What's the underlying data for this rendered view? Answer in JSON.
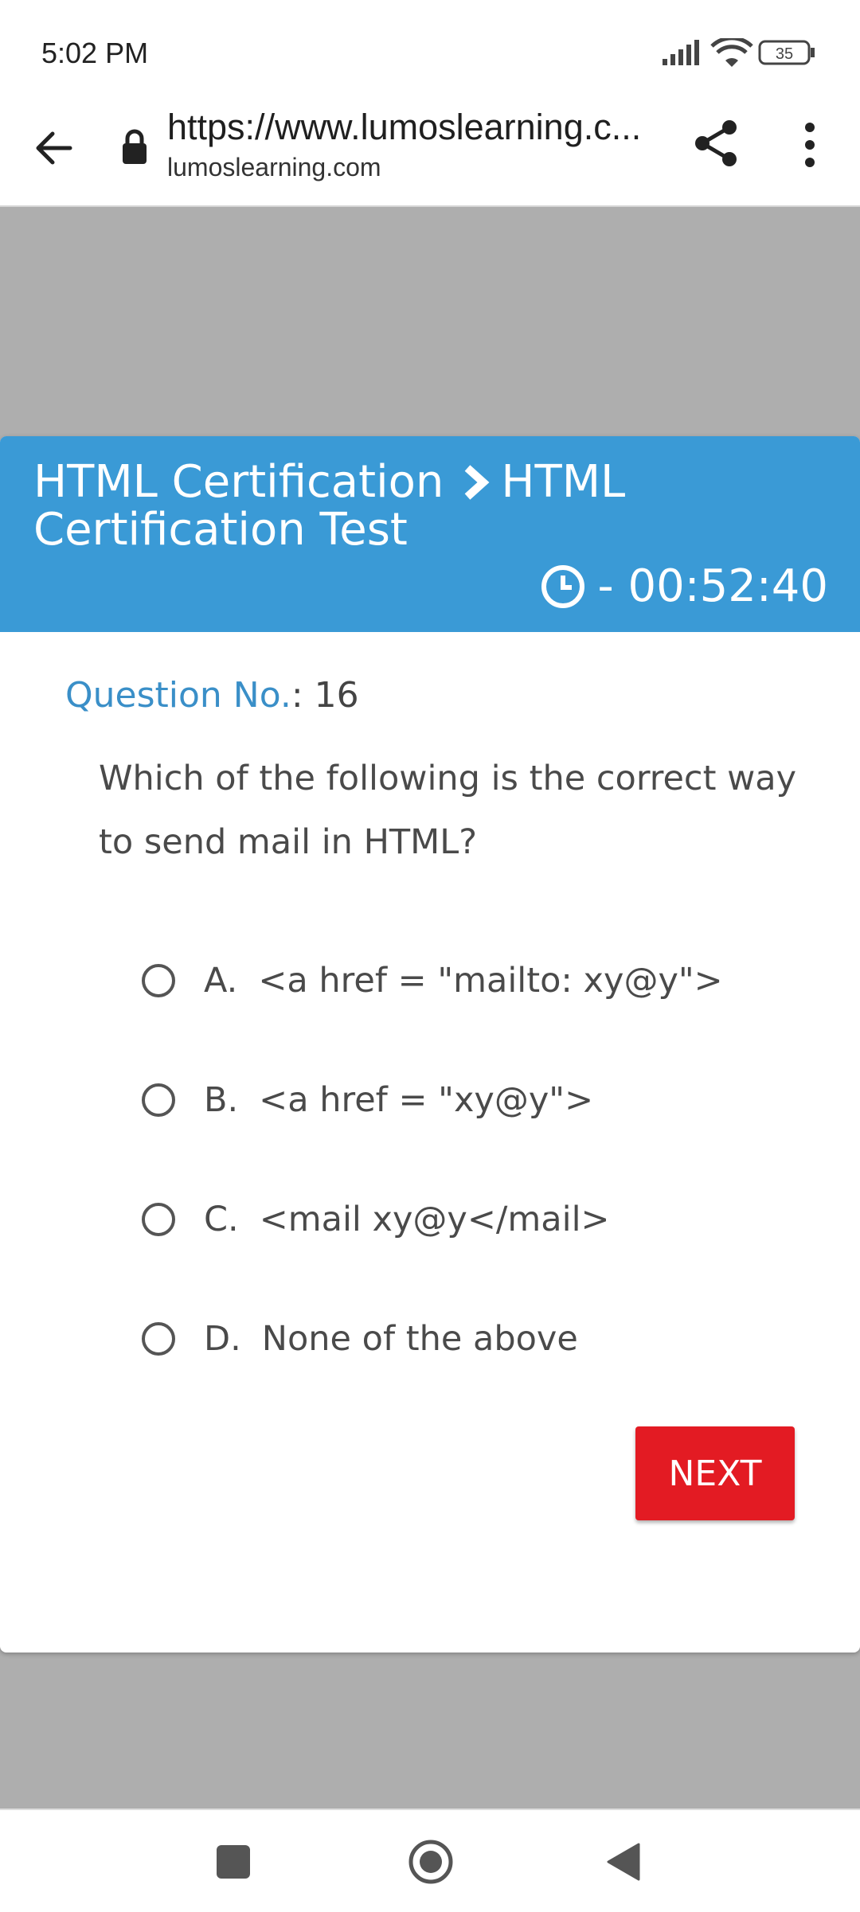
{
  "status_bar": {
    "time": "5:02 PM",
    "battery": "35"
  },
  "browser": {
    "url": "https://www.lumoslearning.c...",
    "domain": "lumoslearning.com"
  },
  "header": {
    "crumb_1": "HTML Certification",
    "crumb_2": "HTML Certification Test",
    "timer": "- 00:52:40"
  },
  "question": {
    "number_label": "Question No.",
    "number_value": ": 16",
    "text": "Which of the following is the correct way to send mail in HTML?"
  },
  "options": [
    {
      "letter": "A.",
      "text": "<a href = \"mailto: xy@y\">"
    },
    {
      "letter": "B.",
      "text": "<a href = \"xy@y\">"
    },
    {
      "letter": "C.",
      "text": "<mail xy@y</mail>"
    },
    {
      "letter": "D.",
      "text": "None of the above"
    }
  ],
  "actions": {
    "next_label": "NEXT"
  },
  "colors": {
    "header_bg": "#3a9ad6",
    "next_bg": "#e31b23",
    "page_bg": "#aeaeae"
  },
  "icons": [
    "signal-icon",
    "wifi-icon",
    "battery-icon",
    "back-arrow-icon",
    "lock-icon",
    "share-icon",
    "more-vert-icon",
    "chevron-right-icon",
    "clock-icon",
    "nav-recent-icon",
    "nav-home-icon",
    "nav-back-icon"
  ]
}
